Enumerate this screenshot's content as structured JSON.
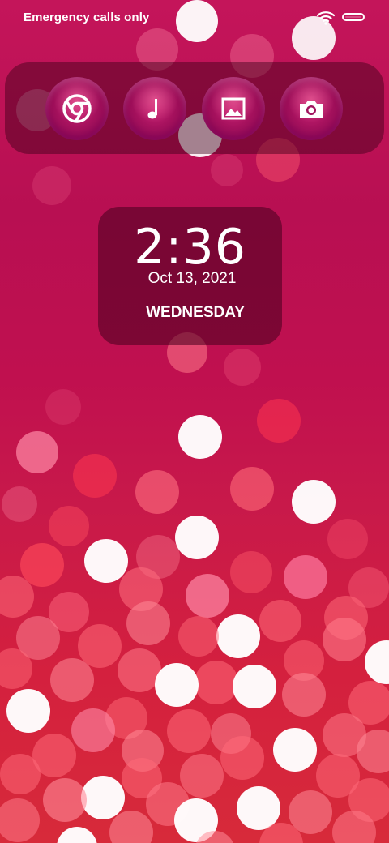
{
  "status_bar": {
    "carrier_text": "Emergency calls only",
    "icons": [
      "wifi-icon",
      "battery-icon"
    ]
  },
  "dock": {
    "apps": [
      {
        "name": "chrome",
        "icon": "chrome-icon"
      },
      {
        "name": "music",
        "icon": "music-note-icon"
      },
      {
        "name": "gallery",
        "icon": "gallery-icon"
      },
      {
        "name": "camera",
        "icon": "camera-icon"
      }
    ]
  },
  "clock": {
    "time": "2:36",
    "date": "Oct 13, 2021",
    "day": "WEDNESDAY"
  },
  "colors": {
    "background_top": "#c4155a",
    "background_bottom": "#d72a3a",
    "bokeh_white": "#ffffff",
    "bokeh_pink": "#ff6b8a",
    "bokeh_red": "#f03a4a"
  }
}
